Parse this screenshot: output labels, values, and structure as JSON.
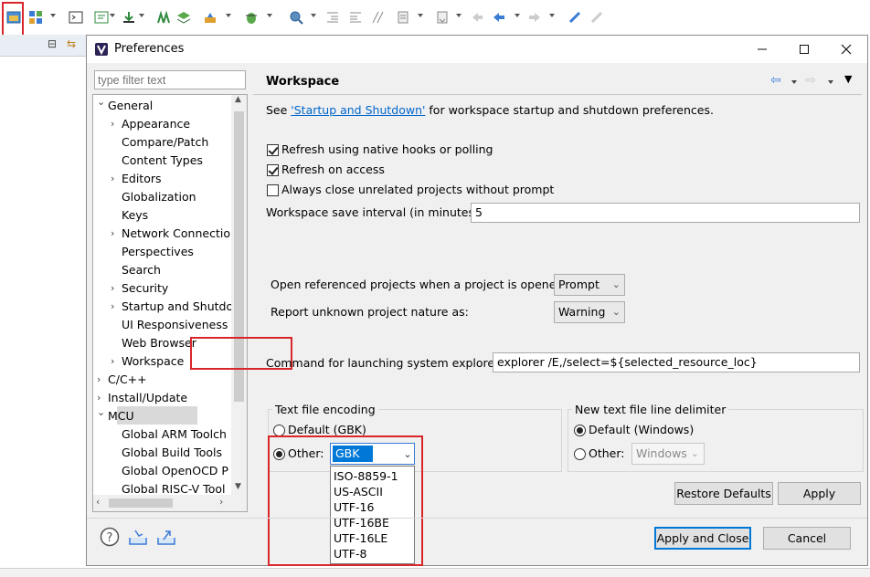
{
  "window": {
    "title": "Preferences"
  },
  "filter": {
    "placeholder": "type filter text"
  },
  "tree": {
    "items": [
      {
        "label": "General",
        "expander": "expanded"
      },
      {
        "label": "Appearance",
        "expander": "collapsed"
      },
      {
        "label": "Compare/Patch",
        "expander": "none"
      },
      {
        "label": "Content Types",
        "expander": "none"
      },
      {
        "label": "Editors",
        "expander": "collapsed"
      },
      {
        "label": "Globalization",
        "expander": "none"
      },
      {
        "label": "Keys",
        "expander": "none"
      },
      {
        "label": "Network Connectio",
        "expander": "collapsed"
      },
      {
        "label": "Perspectives",
        "expander": "none"
      },
      {
        "label": "Search",
        "expander": "none"
      },
      {
        "label": "Security",
        "expander": "collapsed"
      },
      {
        "label": "Startup and Shutdo",
        "expander": "collapsed"
      },
      {
        "label": "UI Responsiveness",
        "expander": "none"
      },
      {
        "label": "Web Browser",
        "expander": "none"
      },
      {
        "label": "Workspace",
        "expander": "collapsed",
        "selected": true
      },
      {
        "label": "C/C++",
        "expander": "collapsed"
      },
      {
        "label": "Install/Update",
        "expander": "collapsed"
      },
      {
        "label": "MCU",
        "expander": "expanded"
      },
      {
        "label": "Global ARM Toolch",
        "expander": "none"
      },
      {
        "label": "Global Build Tools",
        "expander": "none"
      },
      {
        "label": "Global OpenOCD P",
        "expander": "none"
      },
      {
        "label": "Global RISC-V Tool",
        "expander": "none"
      }
    ]
  },
  "page": {
    "title": "Workspace",
    "see_prefix": "See ",
    "see_link": "'Startup and Shutdown'",
    "see_suffix": " for workspace startup and shutdown preferences.",
    "refresh_native": {
      "label": "Refresh using native hooks or polling",
      "checked": true
    },
    "refresh_access": {
      "label": "Refresh on access",
      "checked": true
    },
    "always_close": {
      "label": "Always close unrelated projects without prompt",
      "checked": false
    },
    "save_interval": {
      "label": "Workspace save interval (in minutes):",
      "value": "5"
    },
    "open_referenced": {
      "label": "Open referenced projects when a project is opened:",
      "value": "Prompt"
    },
    "report_unknown": {
      "label": "Report unknown project nature as:",
      "value": "Warning"
    },
    "explorer_cmd": {
      "label": "Command for launching system explorer:",
      "value": "explorer /E,/select=${selected_resource_loc}"
    },
    "encoding": {
      "group_label": "Text file encoding",
      "default_label": "Default (GBK)",
      "other_label": "Other:",
      "value": "GBK",
      "options": [
        "ISO-8859-1",
        "US-ASCII",
        "UTF-16",
        "UTF-16BE",
        "UTF-16LE",
        "UTF-8"
      ]
    },
    "delimiter": {
      "group_label": "New text file line delimiter",
      "default_label": "Default (Windows)",
      "other_label": "Other:",
      "value": "Windows"
    },
    "restore_label": "Restore Defaults",
    "apply_label": "Apply"
  },
  "footer": {
    "apply_close_label": "Apply and Close",
    "cancel_label": "Cancel"
  },
  "colors": {
    "accent": "#0078d7",
    "highlight_box": "#d9262a",
    "link": "#0066cc"
  }
}
